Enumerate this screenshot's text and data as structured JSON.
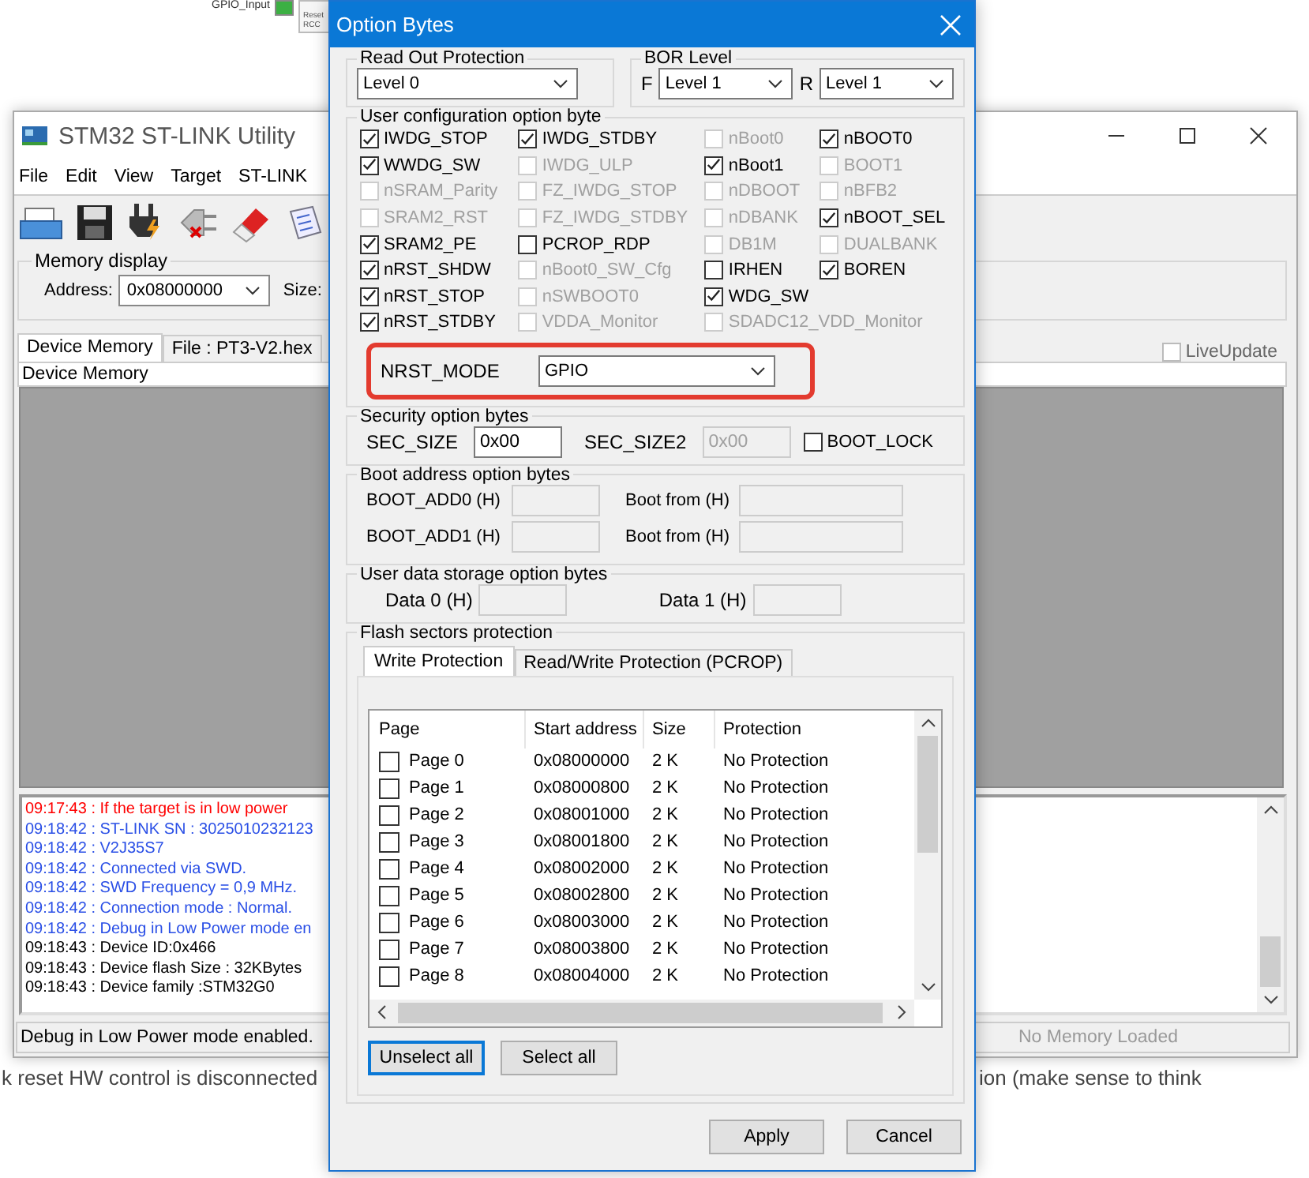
{
  "background_page": {
    "diagram_label": "GPIO_Input",
    "diagram_box_lines": [
      "Reset",
      "RCC"
    ],
    "left_text": "k reset HW control is disconnected",
    "right_text": "ion (make sense to think"
  },
  "stlink_window": {
    "title": "STM32 ST-LINK Utility",
    "menu": [
      "File",
      "Edit",
      "View",
      "Target",
      "ST-LINK"
    ],
    "memory_display": {
      "title": "Memory display",
      "address_label": "Address:",
      "address_value": "0x08000000",
      "size_label": "Size:"
    },
    "tabs": [
      {
        "label": "Device Memory",
        "selected": true
      },
      {
        "label": "File : PT3-V2.hex",
        "selected": false
      }
    ],
    "live_update": {
      "label": "LiveUpdate",
      "checked": false
    },
    "memory_header": "Device Memory",
    "log": [
      {
        "text": "09:17:43 : If the target is in low power",
        "color": "#ff0000"
      },
      {
        "text": "09:18:42 : ST-LINK SN : 3025010232123",
        "color": "#2a4fe6"
      },
      {
        "text": "09:18:42 : V2J35S7",
        "color": "#2a4fe6"
      },
      {
        "text": "09:18:42 : Connected via SWD.",
        "color": "#2a4fe6"
      },
      {
        "text": "09:18:42 : SWD Frequency = 0,9 MHz.",
        "color": "#2a4fe6"
      },
      {
        "text": "09:18:42 : Connection mode : Normal.",
        "color": "#2a4fe6"
      },
      {
        "text": "09:18:42 : Debug in Low Power mode en",
        "color": "#2a4fe6"
      },
      {
        "text": "09:18:43 : Device ID:0x466",
        "color": "#000000"
      },
      {
        "text": "09:18:43 : Device flash Size : 32KBytes",
        "color": "#000000"
      },
      {
        "text": "09:18:43 : Device family :STM32G0",
        "color": "#000000"
      }
    ],
    "status_left": "Debug in Low Power mode enabled.",
    "status_right": "No Memory Loaded"
  },
  "option_bytes": {
    "title": "Option Bytes",
    "read_out_protection": {
      "title": "Read Out Protection",
      "value": "Level 0"
    },
    "bor_level": {
      "title": "BOR Level",
      "f_label": "F",
      "f_value": "Level 1",
      "r_label": "R",
      "r_value": "Level 1"
    },
    "user_config": {
      "title": "User configuration option byte",
      "columns": [
        [
          {
            "label": "IWDG_STOP",
            "checked": true,
            "disabled": false
          },
          {
            "label": "WWDG_SW",
            "checked": true,
            "disabled": false
          },
          {
            "label": "nSRAM_Parity",
            "checked": false,
            "disabled": true
          },
          {
            "label": "SRAM2_RST",
            "checked": false,
            "disabled": true
          },
          {
            "label": "SRAM2_PE",
            "checked": true,
            "disabled": false
          },
          {
            "label": "nRST_SHDW",
            "checked": true,
            "disabled": false
          },
          {
            "label": "nRST_STOP",
            "checked": true,
            "disabled": false
          },
          {
            "label": "nRST_STDBY",
            "checked": true,
            "disabled": false
          }
        ],
        [
          {
            "label": "IWDG_STDBY",
            "checked": true,
            "disabled": false
          },
          {
            "label": "IWDG_ULP",
            "checked": false,
            "disabled": true
          },
          {
            "label": "FZ_IWDG_STOP",
            "checked": false,
            "disabled": true
          },
          {
            "label": "FZ_IWDG_STDBY",
            "checked": false,
            "disabled": true
          },
          {
            "label": "PCROP_RDP",
            "checked": false,
            "disabled": false
          },
          {
            "label": "nBoot0_SW_Cfg",
            "checked": false,
            "disabled": true
          },
          {
            "label": "nSWBOOT0",
            "checked": false,
            "disabled": true
          },
          {
            "label": "VDDA_Monitor",
            "checked": false,
            "disabled": true
          }
        ],
        [
          {
            "label": "nBoot0",
            "checked": false,
            "disabled": true
          },
          {
            "label": "nBoot1",
            "checked": true,
            "disabled": false
          },
          {
            "label": "nDBOOT",
            "checked": false,
            "disabled": true
          },
          {
            "label": "nDBANK",
            "checked": false,
            "disabled": true
          },
          {
            "label": "DB1M",
            "checked": false,
            "disabled": true
          },
          {
            "label": "IRHEN",
            "checked": false,
            "disabled": false
          },
          {
            "label": "WDG_SW",
            "checked": true,
            "disabled": false
          },
          {
            "label": "SDADC12_VDD_Monitor",
            "checked": false,
            "disabled": true
          }
        ],
        [
          {
            "label": "nBOOT0",
            "checked": true,
            "disabled": false
          },
          {
            "label": "BOOT1",
            "checked": false,
            "disabled": true
          },
          {
            "label": "nBFB2",
            "checked": false,
            "disabled": true
          },
          {
            "label": "nBOOT_SEL",
            "checked": true,
            "disabled": false
          },
          {
            "label": "DUALBANK",
            "checked": false,
            "disabled": true
          },
          {
            "label": "BOREN",
            "checked": true,
            "disabled": false
          }
        ]
      ],
      "nrst_mode": {
        "label": "NRST_MODE",
        "value": "GPIO",
        "highlighted": true
      }
    },
    "security": {
      "title": "Security option bytes",
      "fields": [
        {
          "label": "SEC_SIZE",
          "value": "0x00",
          "disabled": false
        },
        {
          "label": "SEC_SIZE2",
          "value": "0x00",
          "disabled": true
        }
      ],
      "boot_lock": {
        "label": "BOOT_LOCK",
        "checked": false
      }
    },
    "boot_address": {
      "title": "Boot address option bytes",
      "rows": [
        {
          "label": "BOOT_ADD0 (H)",
          "from_label": "Boot from (H)"
        },
        {
          "label": "BOOT_ADD1 (H)",
          "from_label": "Boot from (H)"
        }
      ]
    },
    "user_data": {
      "title": "User data storage option bytes",
      "fields": [
        "Data 0 (H)",
        "Data 1 (H)"
      ]
    },
    "flash_protection": {
      "title": "Flash sectors protection",
      "tabs": [
        {
          "label": "Write Protection",
          "selected": true
        },
        {
          "label": "Read/Write Protection (PCROP)",
          "selected": false
        }
      ],
      "columns": [
        "Page",
        "Start address",
        "Size",
        "Protection"
      ],
      "rows": [
        {
          "page": "Page 0",
          "start": "0x08000000",
          "size": "2 K",
          "protection": "No Protection",
          "checked": false
        },
        {
          "page": "Page 1",
          "start": "0x08000800",
          "size": "2 K",
          "protection": "No Protection",
          "checked": false
        },
        {
          "page": "Page 2",
          "start": "0x08001000",
          "size": "2 K",
          "protection": "No Protection",
          "checked": false
        },
        {
          "page": "Page 3",
          "start": "0x08001800",
          "size": "2 K",
          "protection": "No Protection",
          "checked": false
        },
        {
          "page": "Page 4",
          "start": "0x08002000",
          "size": "2 K",
          "protection": "No Protection",
          "checked": false
        },
        {
          "page": "Page 5",
          "start": "0x08002800",
          "size": "2 K",
          "protection": "No Protection",
          "checked": false
        },
        {
          "page": "Page 6",
          "start": "0x08003000",
          "size": "2 K",
          "protection": "No Protection",
          "checked": false
        },
        {
          "page": "Page 7",
          "start": "0x08003800",
          "size": "2 K",
          "protection": "No Protection",
          "checked": false
        },
        {
          "page": "Page 8",
          "start": "0x08004000",
          "size": "2 K",
          "protection": "No Protection",
          "checked": false
        }
      ],
      "buttons": [
        {
          "label": "Unselect all",
          "focused": true
        },
        {
          "label": "Select all",
          "focused": false
        }
      ]
    },
    "buttons": [
      "Apply",
      "Cancel"
    ]
  }
}
